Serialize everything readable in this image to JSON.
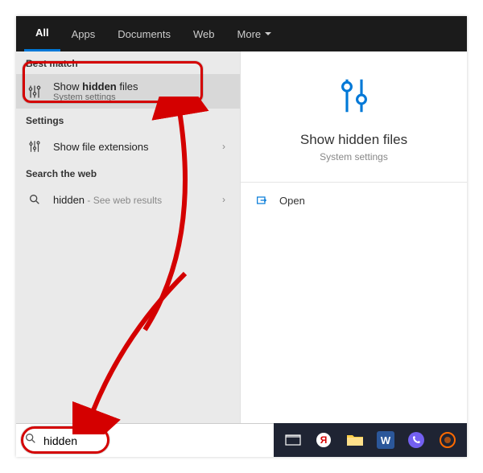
{
  "nav": {
    "tabs": [
      "All",
      "Apps",
      "Documents",
      "Web",
      "More"
    ]
  },
  "left": {
    "best_match_header": "Best match",
    "best_match": {
      "title_pre": "Show ",
      "title_bold": "hidden",
      "title_post": " files",
      "subtitle": "System settings"
    },
    "settings_header": "Settings",
    "settings_item": {
      "title": "Show file extensions"
    },
    "web_header": "Search the web",
    "web_item": {
      "title": "hidden",
      "suffix": " - See web results"
    }
  },
  "right": {
    "title": "Show hidden files",
    "subtitle": "System settings",
    "open": "Open"
  },
  "search": {
    "value": "hidden"
  }
}
